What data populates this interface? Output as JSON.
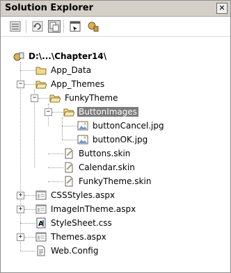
{
  "window": {
    "title": "Solution Explorer",
    "close_label": "✕"
  },
  "toolbar": {
    "buttons": [
      {
        "icon": "properties-icon"
      },
      {
        "icon": "refresh-icon"
      },
      {
        "icon": "nest-related-files-icon"
      },
      {
        "icon": "view-designer-icon"
      },
      {
        "icon": "copy-website-icon"
      }
    ]
  },
  "tree": {
    "root": {
      "label": "D:\\...\\Chapter14\\",
      "icon": "project-icon"
    },
    "items": [
      {
        "label": "App_Data",
        "icon": "folder-icon"
      },
      {
        "label": "App_Themes",
        "icon": "folder-open-icon",
        "expander": "−"
      },
      {
        "label": "FunkyTheme",
        "icon": "folder-open-icon",
        "expander": "−"
      },
      {
        "label": "ButtonImages",
        "icon": "folder-open-icon",
        "expander": "−",
        "selected": true
      },
      {
        "label": "buttonCancel.jpg",
        "icon": "image-file-icon"
      },
      {
        "label": "buttonOK.jpg",
        "icon": "image-file-icon"
      },
      {
        "label": "Buttons.skin",
        "icon": "skin-file-icon"
      },
      {
        "label": "Calendar.skin",
        "icon": "skin-file-icon"
      },
      {
        "label": "FunkyTheme.skin",
        "icon": "skin-file-icon"
      },
      {
        "label": "CSSStyles.aspx",
        "icon": "aspx-file-icon",
        "expander": "+"
      },
      {
        "label": "ImageInTheme.aspx",
        "icon": "aspx-file-icon",
        "expander": "+"
      },
      {
        "label": "StyleSheet.css",
        "icon": "css-file-icon"
      },
      {
        "label": "Themes.aspx",
        "icon": "aspx-file-icon",
        "expander": "+"
      },
      {
        "label": "Web.Config",
        "icon": "config-file-icon"
      }
    ]
  },
  "colors": {
    "selection": "#7a7a7a",
    "folder": "#f2d98a",
    "titlebar": "#d4d0c8"
  }
}
